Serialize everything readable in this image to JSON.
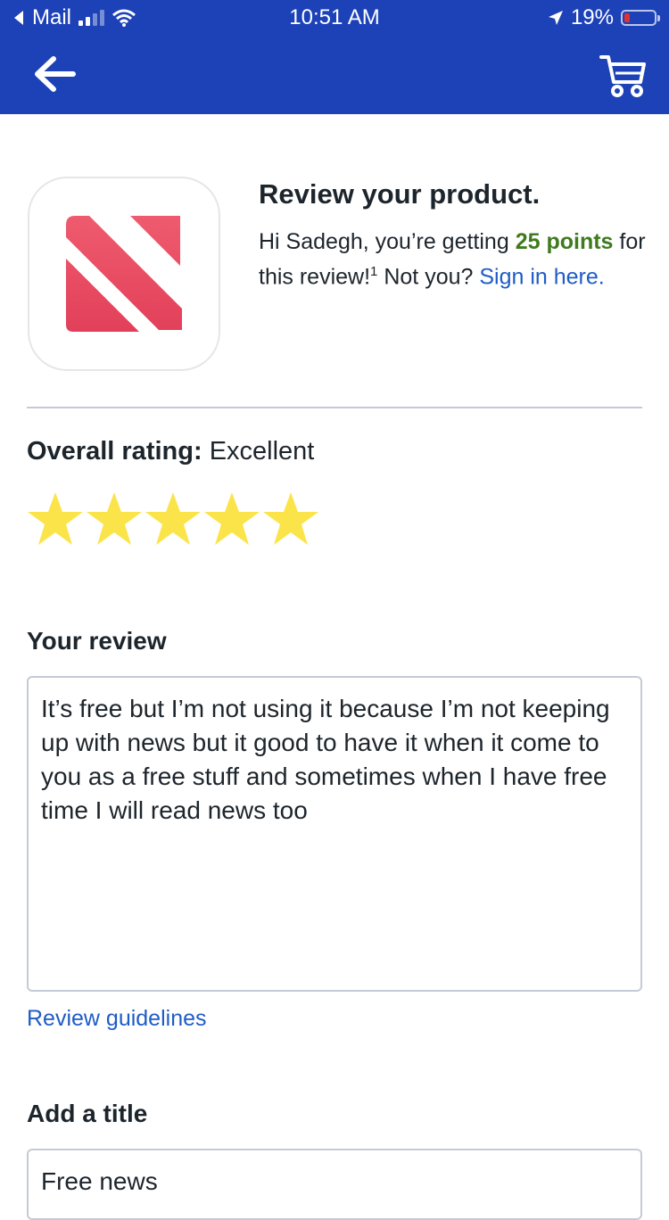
{
  "status_bar": {
    "back_app": "Mail",
    "time": "10:51 AM",
    "battery": "19%"
  },
  "product": {
    "heading": "Review your product.",
    "intro_prefix": "Hi Sadegh, you’re getting",
    "points": "25 points",
    "intro_suffix": "for this review!",
    "footnote": "1",
    "not_you": "Not you?",
    "sign_in": "Sign in here."
  },
  "rating": {
    "label": "Overall rating:",
    "value_text": "Excellent",
    "stars": 5,
    "max": 5,
    "star_color": "#fbe44a"
  },
  "review": {
    "label": "Your review",
    "text": "It’s free but I’m not using it because I’m not keeping up with news but it good to have it when it come to you as a free stuff and sometimes when I have free time I will read news too",
    "guidelines_link": "Review guidelines"
  },
  "title": {
    "label": "Add a title",
    "value": "Free news"
  },
  "colors": {
    "header_blue": "#1d42b8",
    "link_blue": "#1f5cc6",
    "points_green": "#3f7a1f"
  },
  "icons": {
    "back": "arrow-left-icon",
    "cart": "shopping-cart-icon",
    "app": "apple-news-logo"
  }
}
